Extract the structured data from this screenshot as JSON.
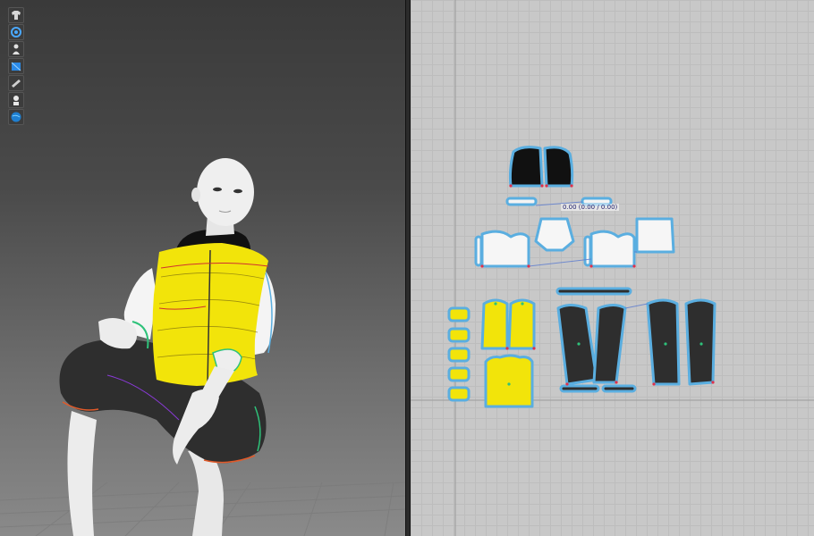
{
  "app": {
    "panels": [
      "3d-garment-view",
      "2d-pattern-view"
    ]
  },
  "toolbar": {
    "tools": [
      {
        "name": "avatar-display-icon"
      },
      {
        "name": "simulation-icon"
      },
      {
        "name": "avatar-pose-icon"
      },
      {
        "name": "texture-view-icon"
      },
      {
        "name": "fabric-thickness-icon"
      },
      {
        "name": "avatar-silhouette-icon"
      },
      {
        "name": "globe-render-icon"
      }
    ]
  },
  "pattern_view": {
    "measurement_label": "0.00 (0.00 / 0.00)"
  },
  "colors": {
    "vest_fabric": "#f2e40a",
    "pants_fabric": "#2e2e2e",
    "sleeve_fabric": "#f4f4f4",
    "hood_fabric": "#111111",
    "pattern_outline": "#5aaee0",
    "grid_bg": "#c8c8c8"
  }
}
